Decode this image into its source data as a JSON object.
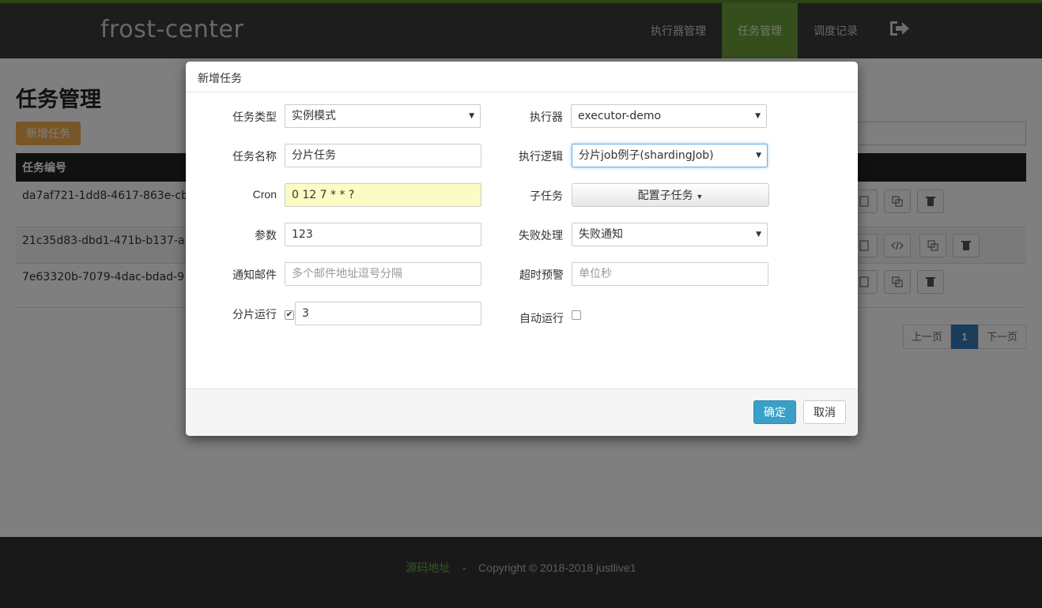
{
  "navbar": {
    "brand": "frost-center",
    "items": [
      "执行器管理",
      "任务管理",
      "调度记录"
    ],
    "active_index": 1,
    "logout_icon": "sign-out-icon"
  },
  "page": {
    "title": "任务管理",
    "add_button": "新增任务",
    "table_header": "任务编号",
    "rows": [
      {
        "id": "da7af721-1dd8-4617-863e-cb"
      },
      {
        "id": "21c35d83-dbd1-471b-b137-a"
      },
      {
        "id": "7e63320b-7079-4dac-bdad-9"
      }
    ],
    "pagination": {
      "prev": "上一页",
      "current": "1",
      "next": "下一页"
    }
  },
  "footer": {
    "source_link": "源码地址",
    "separator": "-",
    "copyright": "Copyright © 2018-2018 justlive1"
  },
  "modal": {
    "title": "新增任务",
    "fields": {
      "task_type": {
        "label": "任务类型",
        "value": "实例模式"
      },
      "executor": {
        "label": "执行器",
        "value": "executor-demo"
      },
      "task_name": {
        "label": "任务名称",
        "value": "分片任务"
      },
      "exec_logic": {
        "label": "执行逻辑",
        "value": "分片job例子(shardingJob)"
      },
      "cron": {
        "label": "Cron",
        "value": "0 12 7 * * ?"
      },
      "subtask": {
        "label": "子任务",
        "button": "配置子任务"
      },
      "params": {
        "label": "参数",
        "value": "123"
      },
      "failure": {
        "label": "失败处理",
        "value": "失败通知"
      },
      "email": {
        "label": "通知邮件",
        "placeholder": "多个邮件地址逗号分隔"
      },
      "timeout": {
        "label": "超时预警",
        "placeholder": "单位秒"
      },
      "sharding": {
        "label": "分片运行",
        "checked": true,
        "value": "3"
      },
      "auto_run": {
        "label": "自动运行",
        "checked": false
      }
    },
    "ok_button": "确定",
    "cancel_button": "取消"
  },
  "colors": {
    "nav_active": "#6b9c36",
    "primary": "#39a0c8",
    "cron_highlight": "#fafcc4",
    "warning": "#f0ad4e"
  }
}
